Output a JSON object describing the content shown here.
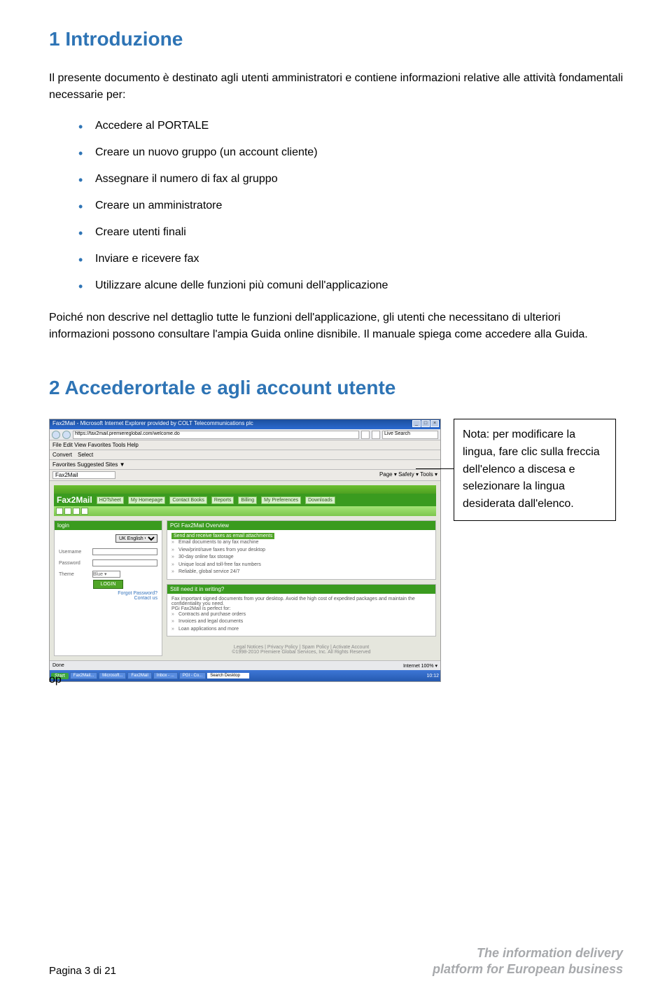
{
  "section1": {
    "heading": "1   Introduzione",
    "intro": "Il presente documento è destinato agli utenti amministratori e contiene informazioni relative alle attività fondamentali necessarie per:",
    "bullets": [
      "Accedere al PORTALE",
      "Creare un nuovo gruppo (un account cliente)",
      "Assegnare il numero di fax al gruppo",
      "Creare un amministratore",
      "Creare utenti finali",
      "Inviare e ricevere fax",
      "Utilizzare alcune delle funzioni più comuni dell'applicazione"
    ],
    "followup": "Poiché non descrive nel dettaglio tutte le funzioni dell'applicazione, gli utenti che necessitano di ulteriori informazioni possono consultare l'ampia Guida online disnibile.  Il manuale spiega come accedere alla Guida."
  },
  "section2": {
    "heading": "2   Accederortale e agli account utente",
    "note": "Nota: per modificare la lingua, fare clic sulla freccia dell'elenco a discesa e selezionare la lingua desiderata dall'elenco.",
    "orphan": "op"
  },
  "browser": {
    "title": "Fax2Mail - Microsoft Internet Explorer provided by COLT Telecommunications plc",
    "url": "https://fax2mail.premiereglobal.com/welcome.do",
    "search_placeholder": "Live Search",
    "menu": "File   Edit   View   Favorites   Tools   Help",
    "toolbar": {
      "convert": "Convert",
      "select": "Select"
    },
    "favorites": "Favorites    Suggested Sites ▼",
    "tab": "Fax2Mail",
    "rightbar": "Page ▾   Safety ▾   Tools ▾",
    "app": {
      "logo": "Fax2Mail",
      "hot": "HOTsheet",
      "nav": [
        "My Homepage",
        "Contact Books",
        "Reports",
        "Billing",
        "My Preferences",
        "Downloads"
      ],
      "login": {
        "header": "login",
        "lang": "UK English ▾",
        "username": "Username",
        "password": "Password",
        "theme": "Theme",
        "theme_value": "Blue  ▾",
        "button": "LOGIN",
        "forgot": "Forgot Password?",
        "contact": "Contact us"
      },
      "overview": {
        "header": "PGI Fax2Mail Overview",
        "lead": "Send and receive faxes as email attachments",
        "items": [
          "Email documents to any fax machine",
          "View/print/save faxes from your desktop",
          "30-day online fax storage",
          "Unique local and toll-free fax numbers",
          "Reliable, global service 24/7"
        ]
      },
      "writing": {
        "header": "Still need it in writing?",
        "lead": "Fax important signed documents from your desktop. Avoid the high cost of expedited packages and maintain the confidentiality you need.",
        "sublead": "PGi Fax2Mail is perfect for:",
        "items": [
          "Contracts and purchase orders",
          "Invoices and legal documents",
          "Loan applications and more"
        ]
      },
      "footer_links": "Legal Notices  |  Privacy Policy  |  Spam Policy  |  Activate Account",
      "copyright": "©1998-2010 Premiere Global Services, Inc. All Rights Reserved"
    },
    "status_left": "Done",
    "status_right": "Internet          100%  ▾",
    "taskbar": {
      "start": "Start",
      "items": [
        "Fax2Mail...",
        "Microsoft...",
        "Fax2Mail",
        "Inbox - ...",
        "PGI - Co..."
      ],
      "search": "Search Desktop",
      "clock": "10:12"
    }
  },
  "footer": {
    "page": "Pagina 3 di 21",
    "tagline1": "The information delivery",
    "tagline2": "platform for European business"
  }
}
